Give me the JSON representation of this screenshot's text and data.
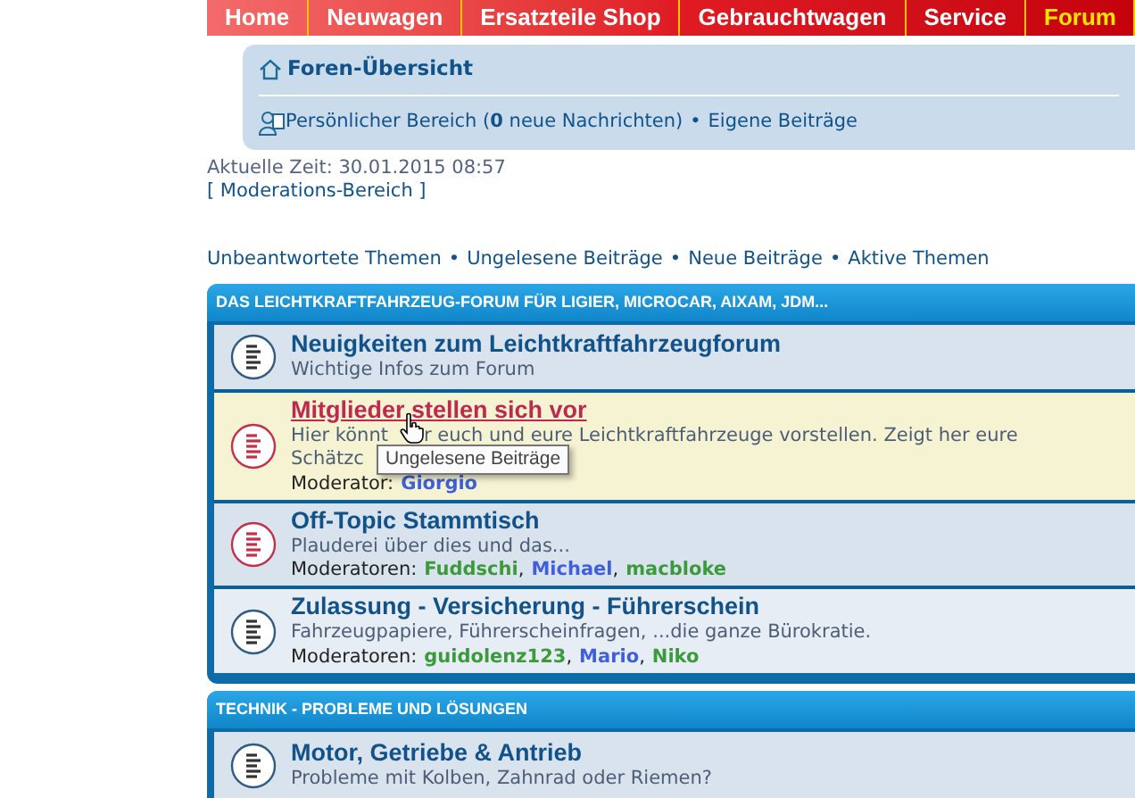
{
  "nav": [
    {
      "label": "Home",
      "selected": false
    },
    {
      "label": "Neuwagen",
      "selected": false
    },
    {
      "label": "Ersatzteile Shop",
      "selected": false
    },
    {
      "label": "Gebrauchtwagen",
      "selected": false
    },
    {
      "label": "Service",
      "selected": false
    },
    {
      "label": "Forum",
      "selected": true
    }
  ],
  "breadcrumb": {
    "title": "Foren-Übersicht",
    "personal": "Persönlicher Bereich (**0** neue Nachrichten)",
    "separator": "•",
    "own_posts": "Eigene Beiträge"
  },
  "time": "Aktuelle Zeit: 30.01.2015 08:57",
  "moderation": "[ Moderations-Bereich ]",
  "quick_links": [
    {
      "label": "Unbeantwortete Themen",
      "separator": "•"
    },
    {
      "label": "Ungelesene Beiträge",
      "separator": "•"
    },
    {
      "label": "Neue Beiträge",
      "separator": "•"
    },
    {
      "label": "Aktive Themen"
    }
  ],
  "categories": [
    {
      "title": "DAS LEICHTKRAFTFAHRZEUG-FORUM FÜR LIGIER, MICROCAR, AIXAM, JDM...",
      "forums": [
        {
          "title": "Neuigkeiten zum Leichtkraftfahrzeugforum",
          "unread": false,
          "hovered": false,
          "description": [
            "Wichtige Infos zum Forum"
          ]
        },
        {
          "title": "Mitglieder stellen sich vor",
          "unread": true,
          "hovered": true,
          "description": [
            "Hier könnt",
            "r euch und eure Leichtkraftfahrzeuge vorstellen. Zeigt her eure",
            "Schätzc"
          ],
          "moderator_label": "Moderator:",
          "moderators": [
            {
              "name": "Giorgio",
              "color": "#3f5fdc"
            }
          ],
          "tooltip": "Ungelesene Beiträge"
        },
        {
          "title": "Off-Topic Stammtisch",
          "unread": true,
          "hovered": false,
          "description": [
            "Plauderei über dies und das..."
          ],
          "moderator_label": "Moderatoren:",
          "moderators": [
            {
              "name": "Fuddschi",
              "color": "#3c9a3c",
              "separator": ","
            },
            {
              "name": "Michael",
              "color": "#3f5fdc",
              "separator": ","
            },
            {
              "name": "macbloke",
              "color": "#3c9a3c"
            }
          ]
        },
        {
          "title": "Zulassung - Versicherung - Führerschein",
          "unread": false,
          "hovered": false,
          "description": [
            "Fahrzeugpapiere, Führerscheinfragen, ...die ganze Bürokratie."
          ],
          "moderator_label": "Moderatoren:",
          "moderators": [
            {
              "name": "guidolenz123",
              "color": "#3c9a3c",
              "separator": ","
            },
            {
              "name": "Mario",
              "color": "#3f5fdc",
              "separator": ","
            },
            {
              "name": "Niko",
              "color": "#3c9a3c"
            }
          ]
        }
      ]
    },
    {
      "title": "TECHNIK - PROBLEME UND LÖSUNGEN",
      "forums": [
        {
          "title": "Motor, Getriebe & Antrieb",
          "unread": false,
          "hovered": false,
          "description": [
            "Probleme mit Kolben, Zahnrad oder Riemen?"
          ]
        }
      ]
    }
  ]
}
